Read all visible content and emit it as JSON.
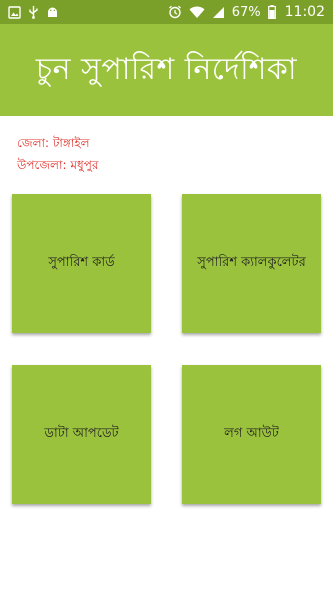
{
  "status_bar": {
    "battery": "67%",
    "time": "11:02",
    "icons_left": [
      "image-icon",
      "usb-icon",
      "android-icon"
    ],
    "icons_right": [
      "alarm-icon",
      "wifi-icon",
      "signal-icon",
      "battery-icon"
    ]
  },
  "header": {
    "title": "চুন সুপারিশ নির্দেশিকা"
  },
  "location": {
    "district": "জেলা: টাঙ্গাইল",
    "upazila": "উপজেলা: মধুপুর"
  },
  "tiles": [
    {
      "label": "সুপারিশ কার্ড"
    },
    {
      "label": "সুপারিশ ক্যালকুলেটর"
    },
    {
      "label": "ডাটা আপডেট"
    },
    {
      "label": "লগ আউট"
    }
  ],
  "colors": {
    "status_bar": "#7ba02a",
    "primary": "#9bc23c",
    "location_text": "#e0302a"
  }
}
